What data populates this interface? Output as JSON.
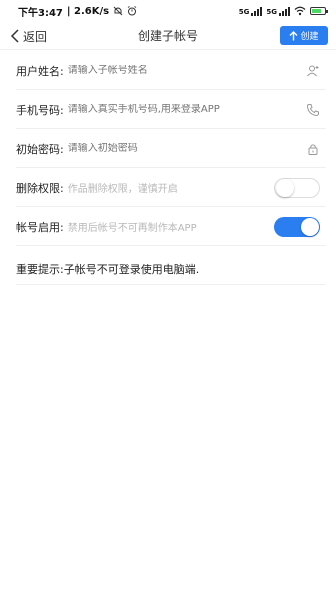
{
  "status_bar": {
    "time": "下午3:47",
    "net_speed": "| 2.6K/s",
    "signal1": "5G",
    "signal2": "5G",
    "battery_color": "#4cd964"
  },
  "nav": {
    "back_label": "返回",
    "title": "创建子帐号",
    "create_label": "创建",
    "accent": "#2a7ef0"
  },
  "form": {
    "username": {
      "label": "用户姓名:",
      "placeholder": "请输入子帐号姓名",
      "icon": "user-add-icon"
    },
    "phone": {
      "label": "手机号码:",
      "placeholder": "请输入真实手机号码,用来登录APP",
      "icon": "phone-icon"
    },
    "password": {
      "label": "初始密码:",
      "placeholder": "请输入初始密码",
      "icon": "lock-icon"
    },
    "delete_permission": {
      "label": "删除权限:",
      "hint": "作品删除权限，谨慎开启",
      "enabled": false
    },
    "account_enabled": {
      "label": "帐号启用:",
      "hint": "禁用后帐号不可再制作本APP",
      "enabled": true
    }
  },
  "notice": "重要提示:子帐号不可登录使用电脑端."
}
